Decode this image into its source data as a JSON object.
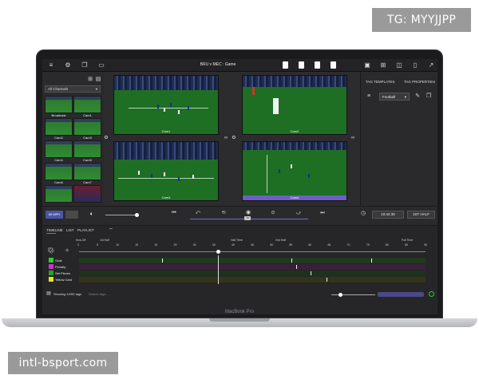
{
  "watermarks": {
    "top_right": "TG: MYYJJPP",
    "bottom_left": "intl-bsport.com"
  },
  "device": {
    "brand": "MacBook Pro"
  },
  "app": {
    "title": "BRU v MEC : Game",
    "channel_select": "All Channels",
    "cameras": [
      "Broadcast",
      "Cam1",
      "Cam2",
      "Cam3",
      "Cam4",
      "Cam5",
      "Cam6",
      "Cam7"
    ],
    "video_labels": [
      "Cam1",
      "Cam2",
      "Cam3",
      "Cam4"
    ],
    "right_tabs": [
      "TAG TEMPLATES",
      "TAG PROPERTIES"
    ],
    "template_select": "Football",
    "controls": {
      "left_btn_1": "60 MPH",
      "left_btn_2": "",
      "speed_label": "1x",
      "timecode": "10:42:35",
      "action_btn": "1ST HALF"
    },
    "bottom_tabs": [
      "TIMELINE",
      "LIST",
      "PLAYLIST"
    ],
    "ruler_markers": [
      "Kick-Off",
      "1st Half",
      "Half Time",
      "2nd Half",
      "Full Time"
    ],
    "ruler_ticks": [
      "0",
      "5",
      "10",
      "15",
      "20",
      "25",
      "30",
      "35",
      "40",
      "45",
      "50",
      "55",
      "60",
      "65",
      "70",
      "75",
      "80",
      "85",
      "90"
    ],
    "tag_types": [
      {
        "label": "Goal",
        "color": "#2bd12b"
      },
      {
        "label": "Penalty",
        "color": "#d62bd6"
      },
      {
        "label": "Set Pieces",
        "color": "#1ea81e"
      },
      {
        "label": "Yellow Card",
        "color": "#e6e61a"
      }
    ],
    "footer": {
      "count": "Showing 10/50 tags",
      "search_placeholder": "Search tags..."
    }
  }
}
